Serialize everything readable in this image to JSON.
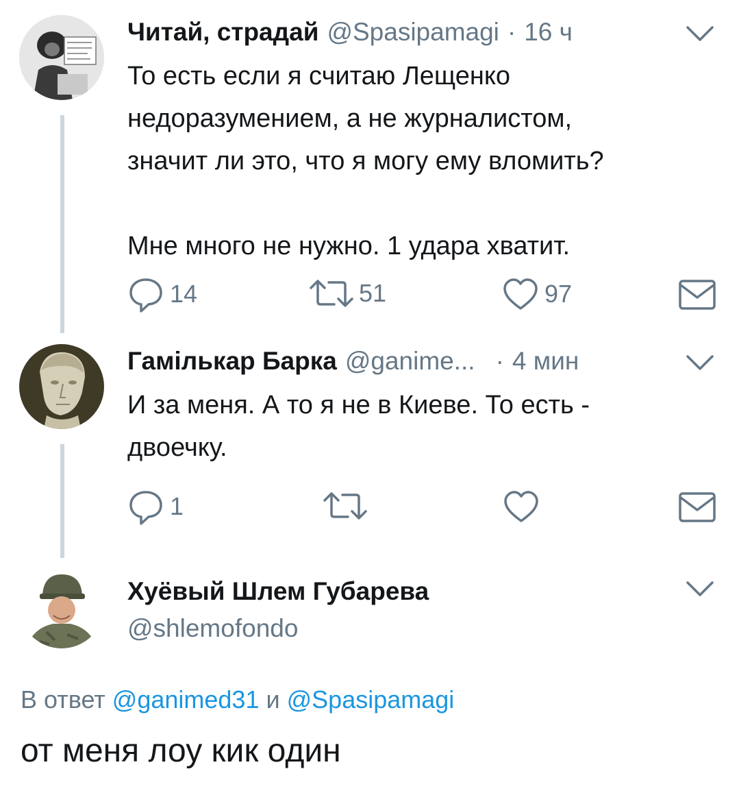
{
  "tweets": [
    {
      "name": "Читай, страдай",
      "handle": "@Spasipamagi",
      "sep": "·",
      "time": "16 ч",
      "text": "То есть если я считаю Лещенко\nнедоразумением, а не журналистом,\nзначит ли это, что я могу ему вломить?\n\nМне много не нужно. 1 удара хватит.",
      "replies": "14",
      "retweets": "51",
      "likes": "97"
    },
    {
      "name": "Гамількар Барка",
      "handle": "@ganime...",
      "sep": "·",
      "time": "4 мин",
      "text": "И за меня. А то я не в Киеве. То есть  -\nдвоечку.",
      "replies": "1",
      "retweets": "",
      "likes": ""
    }
  ],
  "main": {
    "name": "Хуёвый Шлем Губарева",
    "handle": "@shlemofondo",
    "reply_prefix": "В ответ",
    "reply_user1": "@ganimed31",
    "reply_and": "и",
    "reply_user2": "@Spasipamagi",
    "text": "от меня лоу кик один"
  },
  "icons": {
    "reply": "reply-icon",
    "retweet": "retweet-icon",
    "like": "heart-icon",
    "dm": "envelope-icon",
    "menu": "chevron-down-icon"
  },
  "colors": {
    "text": "#14171a",
    "secondary": "#657786",
    "link": "#1b95e0",
    "thread_line": "#ccd6dd"
  }
}
